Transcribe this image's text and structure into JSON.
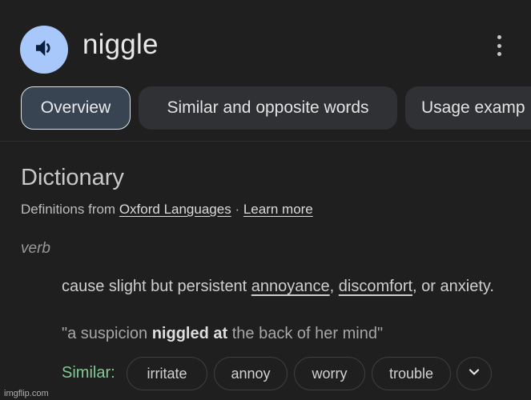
{
  "header": {
    "word": "niggle",
    "speaker_icon": "volume-icon",
    "menu_icon": "more-vert-icon"
  },
  "tabs": [
    {
      "label": "Overview",
      "active": true
    },
    {
      "label": "Similar and opposite words",
      "active": false
    },
    {
      "label": "Usage examp",
      "active": false
    }
  ],
  "dictionary": {
    "title": "Dictionary",
    "source_prefix": "Definitions from ",
    "source_link": "Oxford Languages",
    "separator": " · ",
    "learn_more": "Learn more",
    "part_of_speech": "verb",
    "definition": {
      "part1": "cause slight but persistent ",
      "link1": "annoyance",
      "part2": ", ",
      "link2": "discomfort",
      "part3": ", or anxiety."
    },
    "example": {
      "before": "\"a suspicion ",
      "bold": "niggled at",
      "after": " the back of her mind\""
    },
    "similar_label": "Similar:",
    "similar_words": [
      "irritate",
      "annoy",
      "worry",
      "trouble"
    ],
    "expand_icon": "chevron-down-icon"
  },
  "watermark": "imgflip.com",
  "colors": {
    "background": "#1f1f1f",
    "speaker_bg": "#a8c7fa",
    "speaker_fg": "#0b1f3a",
    "tab_bg": "#303134",
    "tab_active_bg": "#394453",
    "similar_green": "#81c995"
  }
}
